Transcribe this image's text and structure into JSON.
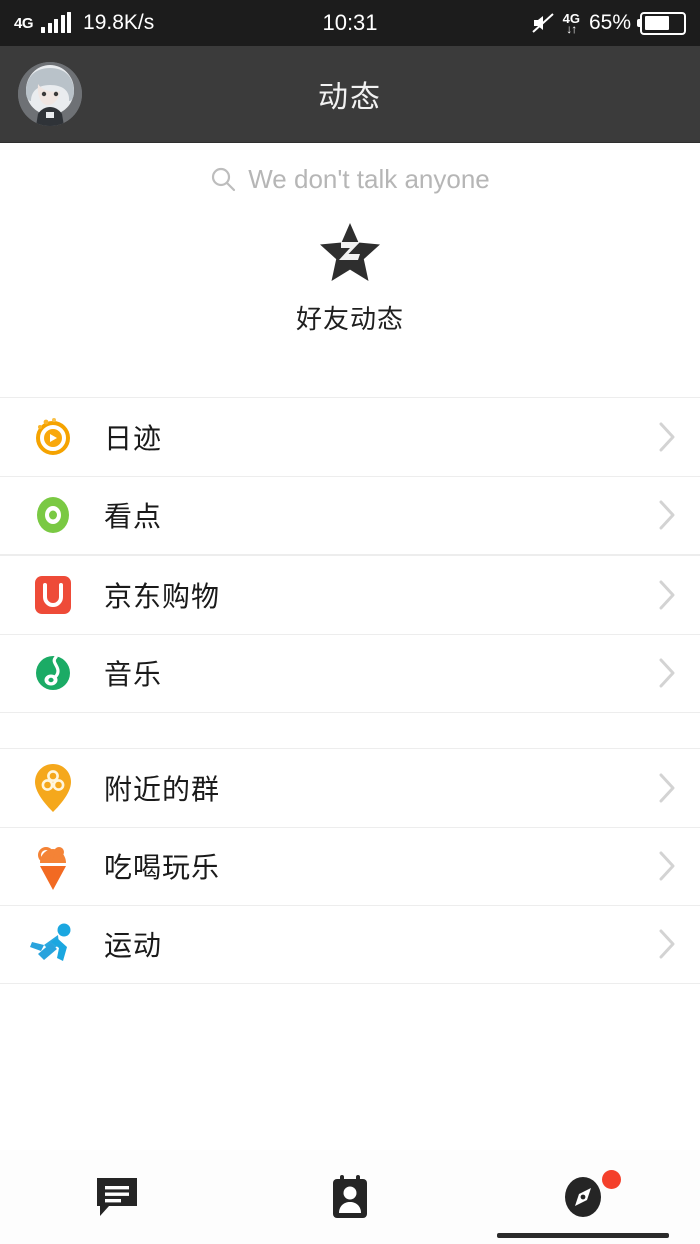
{
  "status_bar": {
    "network_type": "4G",
    "speed": "19.8K/s",
    "clock": "10:31",
    "data_indicator": "4G",
    "battery_percent": "65%",
    "battery_level": 65,
    "mute_icon": "speaker-muted-icon",
    "signal_icon": "signal-bars-icon"
  },
  "header": {
    "title": "动态",
    "avatar_name": "user-avatar"
  },
  "search": {
    "placeholder": "We don't talk anyone",
    "icon": "search-icon"
  },
  "feature": {
    "label": "好友动态",
    "icon": "star-z-icon"
  },
  "groups": [
    {
      "items": [
        {
          "label": "日迹",
          "icon": "daily-trace-icon",
          "color": "#f7a400"
        },
        {
          "label": "看点",
          "icon": "highlights-icon",
          "color": "#7ac943"
        }
      ]
    },
    {
      "items": [
        {
          "label": "京东购物",
          "icon": "jd-shopping-icon",
          "color": "#ee4b38"
        },
        {
          "label": "音乐",
          "icon": "music-note-icon",
          "color": "#1bab65"
        }
      ]
    },
    {
      "items": [
        {
          "label": "附近的群",
          "icon": "location-pin-icon",
          "color": "#f5a81c"
        },
        {
          "label": "吃喝玩乐",
          "icon": "ice-cream-icon",
          "color": "#f07c2a"
        },
        {
          "label": "运动",
          "icon": "running-icon",
          "color": "#1ba7e0"
        }
      ]
    }
  ],
  "tabbar": {
    "tabs": [
      {
        "name": "messages-tab",
        "icon": "chat-bubble-icon",
        "active": false,
        "badge": false
      },
      {
        "name": "contacts-tab",
        "icon": "contacts-card-icon",
        "active": false,
        "badge": false
      },
      {
        "name": "discover-tab",
        "icon": "compass-icon",
        "active": true,
        "badge": true
      }
    ]
  },
  "colors": {
    "status_bar_bg": "#1c1c1c",
    "header_bg": "#3b3b3b",
    "page_bg": "#ffffff",
    "divider": "#ededed",
    "badge": "#f4402b",
    "chevron": "#cccccc"
  }
}
